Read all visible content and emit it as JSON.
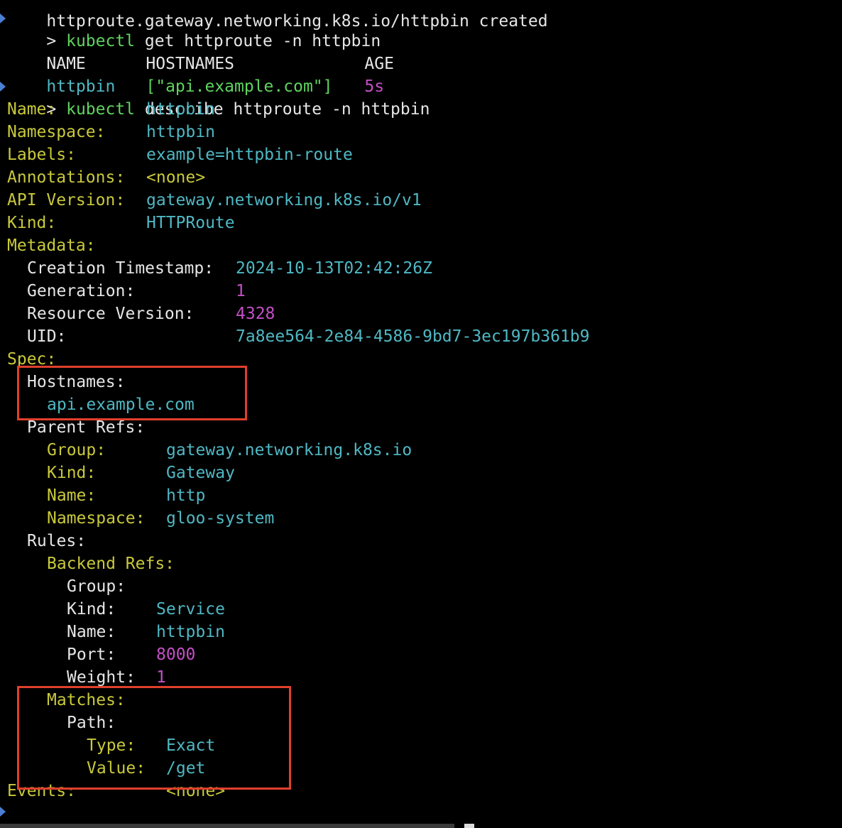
{
  "top_partial_line": "httproute.gateway.networking.k8s.io/httpbin created",
  "cmd1": {
    "prompt": "> ",
    "program": "kubectl",
    "args": " get httproute -n httpbin"
  },
  "table": {
    "headers": [
      "NAME",
      "HOSTNAMES",
      "AGE"
    ],
    "row": {
      "name": "httpbin",
      "hostnames": "[\"api.example.com\"]",
      "age": "5s"
    }
  },
  "cmd2": {
    "prompt": "> ",
    "program": "kubectl",
    "args": " describe httproute -n httpbin"
  },
  "describe": {
    "name_key": "Name:",
    "name_val": "httpbin",
    "namespace_key": "Namespace:",
    "namespace_val": "httpbin",
    "labels_key": "Labels:",
    "labels_val": "example=httpbin-route",
    "annotations_key": "Annotations:",
    "annotations_val": "<none>",
    "api_version_key": "API Version:",
    "api_version_val": "gateway.networking.k8s.io/v1",
    "kind_key": "Kind:",
    "kind_val": "HTTPRoute",
    "metadata_key": "Metadata:",
    "creation_key": "Creation Timestamp:",
    "creation_val": "2024-10-13T02:42:26Z",
    "generation_key": "Generation:",
    "generation_val": "1",
    "resource_version_key": "Resource Version:",
    "resource_version_val": "4328",
    "uid_key": "UID:",
    "uid_val": "7a8ee564-2e84-4586-9bd7-3ec197b361b9",
    "spec_key": "Spec:",
    "hostnames_key": "Hostnames:",
    "hostnames_val": "api.example.com",
    "parent_refs_key": "Parent Refs:",
    "pr_group_key": "Group:",
    "pr_group_val": "gateway.networking.k8s.io",
    "pr_kind_key": "Kind:",
    "pr_kind_val": "Gateway",
    "pr_name_key": "Name:",
    "pr_name_val": "http",
    "pr_namespace_key": "Namespace:",
    "pr_namespace_val": "gloo-system",
    "rules_key": "Rules:",
    "backend_refs_key": "Backend Refs:",
    "br_group_key": "Group:",
    "br_kind_key": "Kind:",
    "br_kind_val": "Service",
    "br_name_key": "Name:",
    "br_name_val": "httpbin",
    "br_port_key": "Port:",
    "br_port_val": "8000",
    "br_weight_key": "Weight:",
    "br_weight_val": "1",
    "matches_key": "Matches:",
    "path_key": "Path:",
    "type_key": "Type:",
    "type_val": "Exact",
    "value_key": "Value:",
    "value_val": "/get",
    "events_key": "Events:",
    "events_val": "<none>"
  },
  "colors": {
    "background": "#000000",
    "key_yellow": "#c9c93c",
    "value_cyan": "#4fb8c4",
    "command_green": "#5fd35f",
    "number_magenta": "#c44fc6",
    "highlight_red": "#e0402c"
  }
}
